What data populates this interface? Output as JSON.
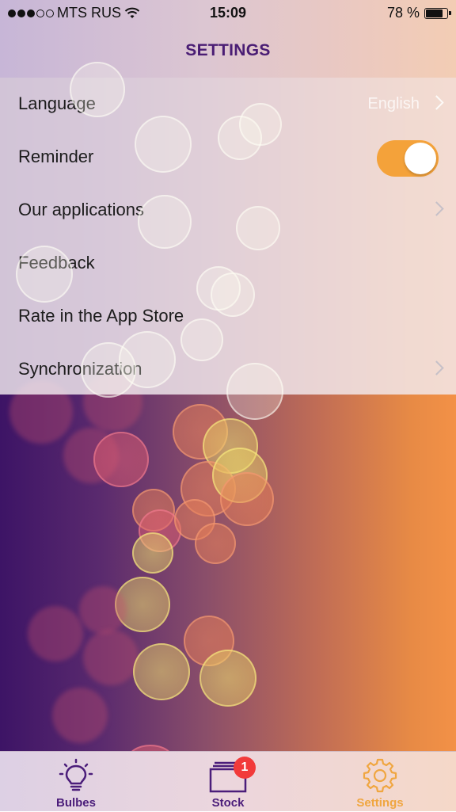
{
  "status_bar": {
    "carrier": "MTS RUS",
    "time": "15:09",
    "battery": "78 %"
  },
  "nav": {
    "title": "SETTINGS"
  },
  "settings": {
    "language": {
      "label": "Language",
      "value": "English"
    },
    "reminder": {
      "label": "Reminder",
      "enabled": true
    },
    "our_applications": {
      "label": "Our applications"
    },
    "feedback": {
      "label": "Feedback"
    },
    "rate": {
      "label": "Rate in the App Store"
    },
    "synchronization": {
      "label": "Synchronization"
    }
  },
  "tabbar": {
    "tabs": [
      {
        "label": "Bulbes",
        "icon": "lightbulb-icon",
        "color": "#4b1d7a"
      },
      {
        "label": "Stock",
        "icon": "stock-icon",
        "color": "#4b1d7a",
        "badge": "1"
      },
      {
        "label": "Settings",
        "icon": "gear-icon",
        "color": "#f0a640",
        "active": true
      }
    ]
  },
  "colors": {
    "accent": "#f4a23a",
    "title": "#4a1d74",
    "badge": "#f23a3a"
  }
}
